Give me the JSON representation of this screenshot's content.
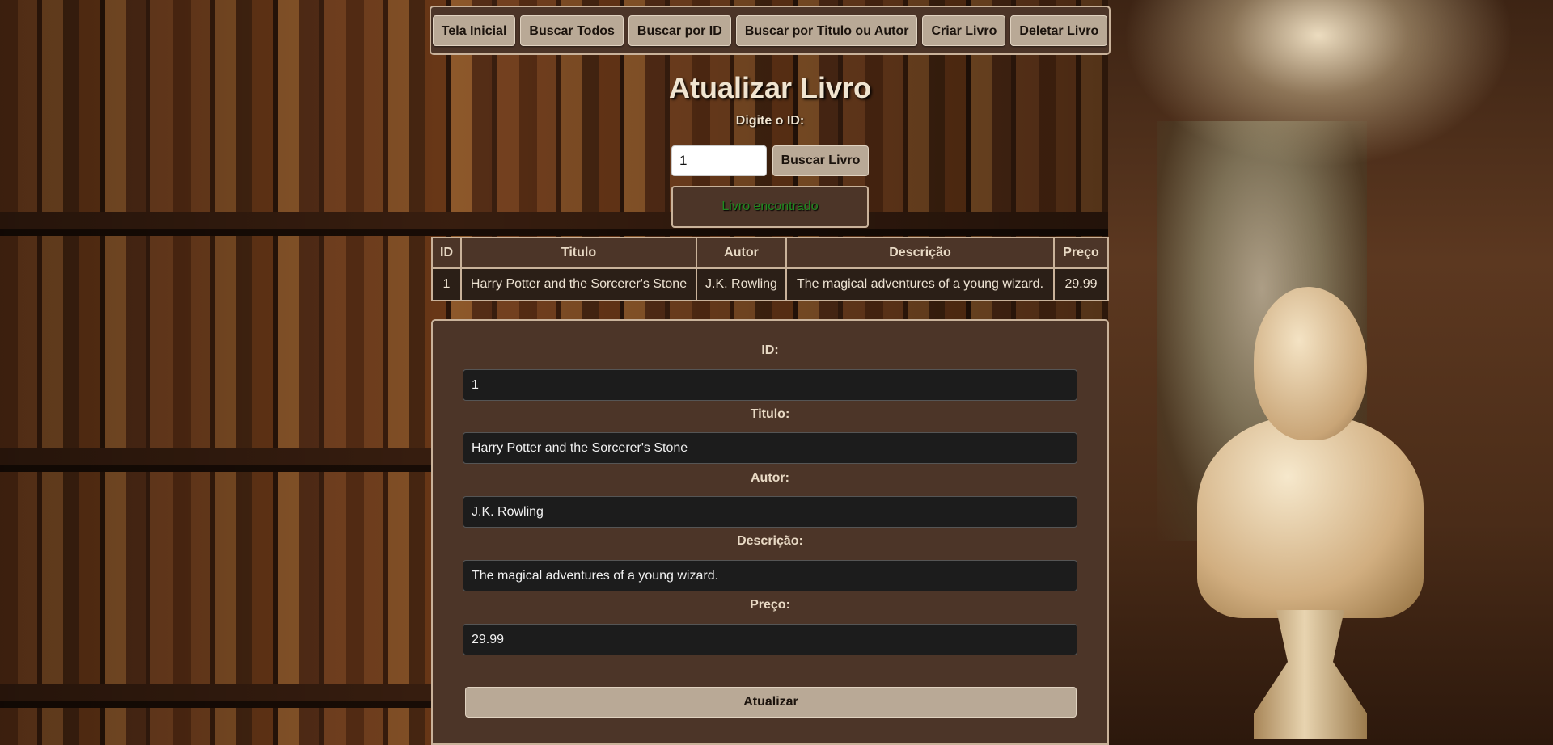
{
  "nav": {
    "items": [
      "Tela Inicial",
      "Buscar Todos",
      "Buscar por ID",
      "Buscar por Titulo ou Autor",
      "Criar Livro",
      "Deletar Livro"
    ]
  },
  "page": {
    "title": "Atualizar Livro",
    "id_prompt": "Digite o ID:"
  },
  "search": {
    "value": "1",
    "button_label": "Buscar Livro"
  },
  "status": {
    "message": "Livro encontrado",
    "color": "#1f8a1f"
  },
  "table": {
    "headers": [
      "ID",
      "Titulo",
      "Autor",
      "Descrição",
      "Preço"
    ],
    "rows": [
      [
        "1",
        "Harry Potter and the Sorcerer's Stone",
        "J.K. Rowling",
        "The magical adventures of a young wizard.",
        "29.99"
      ]
    ]
  },
  "form": {
    "id_label": "ID:",
    "id_value": "1",
    "title_label": "Titulo:",
    "title_value": "Harry Potter and the Sorcerer's Stone",
    "author_label": "Autor:",
    "author_value": "J.K. Rowling",
    "description_label": "Descrição:",
    "description_value": "The magical adventures of a young wizard.",
    "price_label": "Preço:",
    "price_value": "29.99",
    "submit_label": "Atualizar"
  },
  "theme": {
    "panel": "#4c3528",
    "border": "#c9b29a",
    "button": "#b9a996"
  }
}
